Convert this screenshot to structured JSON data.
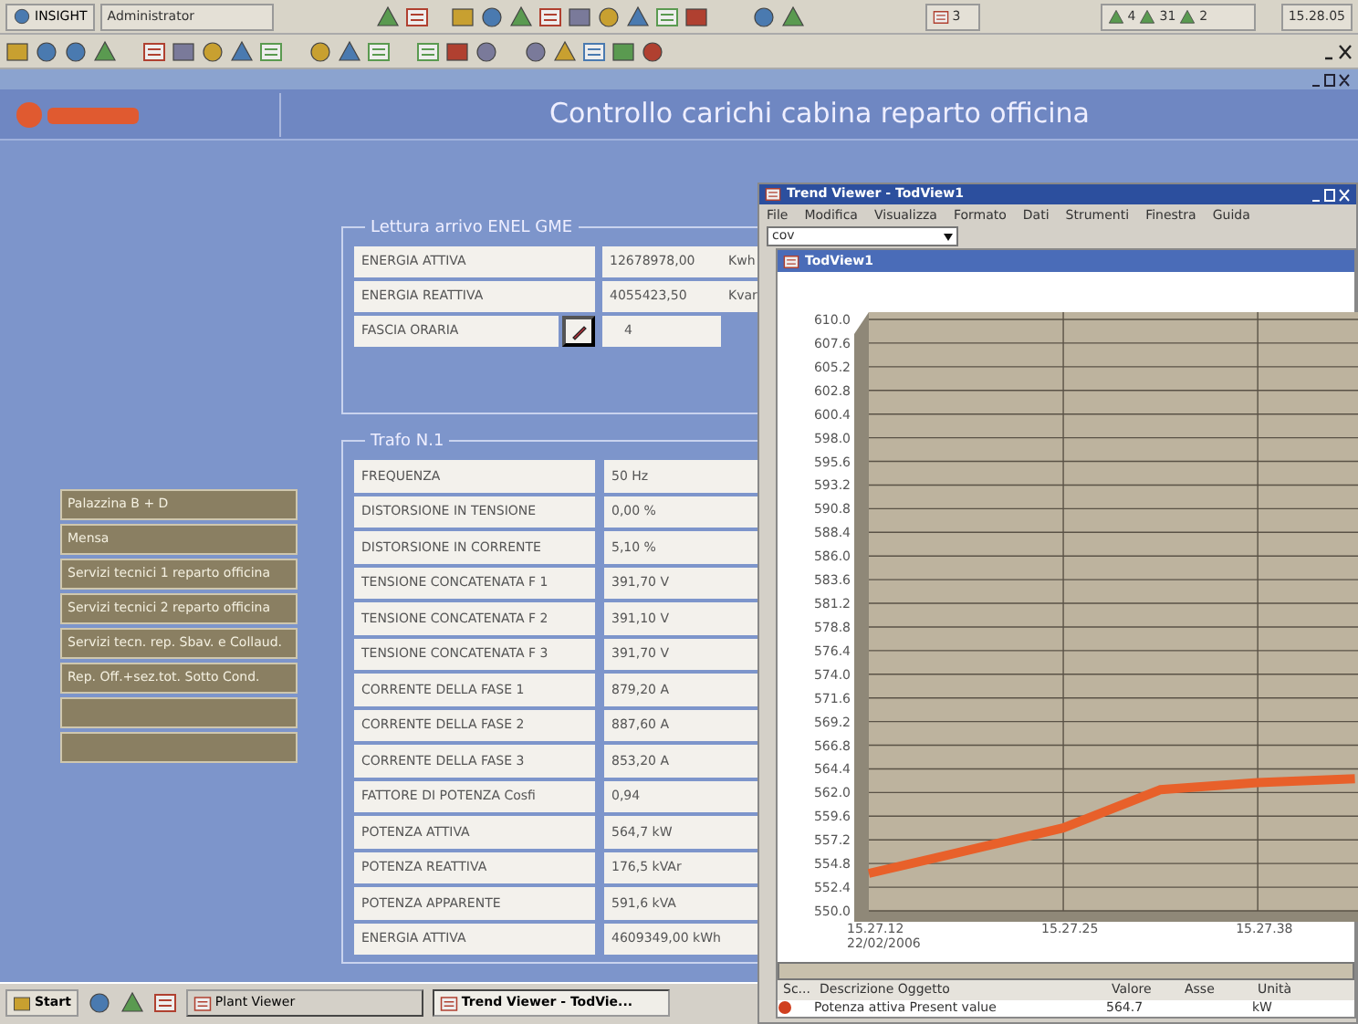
{
  "app_toolbar": {
    "app_button": "INSIGHT",
    "user": "Administrator",
    "counter": "3",
    "alarms": [
      {
        "count": "4"
      },
      {
        "count": "31"
      },
      {
        "count": "2"
      }
    ],
    "time": "15.28.05"
  },
  "header": {
    "title": "Controllo carichi cabina reparto officina"
  },
  "sidebar": {
    "items": [
      {
        "kind": "label",
        "label": "Palazzina B + D"
      },
      {
        "kind": "label",
        "label": "Mensa"
      },
      {
        "kind": "label",
        "label": "Servizi tecnici 1 reparto officina"
      },
      {
        "kind": "label",
        "label": "Servizi tecnici 2 reparto officina"
      },
      {
        "kind": "label",
        "label": "Servizi tecn. rep. Sbav. e Collaud."
      },
      {
        "kind": "label",
        "label": "Rep. Off.+sez.tot. Sotto Cond."
      },
      {
        "kind": "blank"
      },
      {
        "kind": "blank"
      }
    ]
  },
  "enel_reading": {
    "title": "Lettura arrivo ENEL GME",
    "rows": [
      {
        "kind": "plain",
        "label": "ENERGIA ATTIVA",
        "value": "12678978,00",
        "unit": "Kwh"
      },
      {
        "kind": "plain",
        "label": "ENERGIA REATTIVA",
        "value": "4055423,50",
        "unit": "Kvar"
      },
      {
        "kind": "button",
        "label": "FASCIA ORARIA",
        "value": "4"
      }
    ]
  },
  "transformer": {
    "title": "Trafo N.1",
    "rows": [
      {
        "label": "FREQUENZA",
        "value": "50 Hz"
      },
      {
        "label": "DISTORSIONE IN TENSIONE",
        "value": "0,00 %"
      },
      {
        "label": "DISTORSIONE IN CORRENTE",
        "value": "5,10 %"
      },
      {
        "label": "TENSIONE CONCATENATA F 1",
        "value": "391,70 V"
      },
      {
        "label": "TENSIONE CONCATENATA F 2",
        "value": "391,10 V"
      },
      {
        "label": "TENSIONE CONCATENATA F 3",
        "value": "391,70 V"
      },
      {
        "label": "CORRENTE DELLA FASE 1",
        "value": "879,20 A"
      },
      {
        "label": "CORRENTE DELLA FASE 2",
        "value": "887,60 A"
      },
      {
        "label": "CORRENTE DELLA FASE 3",
        "value": "853,20 A"
      },
      {
        "label": "FATTORE DI POTENZA Cosfi",
        "value": "0,94"
      },
      {
        "label": "POTENZA ATTIVA",
        "value": "564,7 kW"
      },
      {
        "label": "POTENZA REATTIVA",
        "value": "176,5 kVAr"
      },
      {
        "label": "POTENZA APPARENTE",
        "value": "591,6 kVA"
      },
      {
        "label": "ENERGIA ATTIVA",
        "value": "4609349,00 kWh"
      }
    ]
  },
  "trend_viewer": {
    "title": "Trend Viewer - TodView1",
    "menu": [
      "File",
      "Modifica",
      "Visualizza",
      "Formato",
      "Dati",
      "Strumenti",
      "Finestra",
      "Guida"
    ],
    "combo_value": "cov",
    "subwindow_title": "TodView1",
    "start_date": "22/02/2006",
    "chart_data": {
      "type": "line",
      "categories": [
        "15.27.12",
        null,
        "15.27.25",
        null,
        "15.27.38",
        null
      ],
      "series": [
        {
          "color": "#e8602a",
          "values": [
            553.8,
            556.1,
            558.4,
            562.3,
            563.0,
            563.4
          ]
        }
      ],
      "ylim": [
        550,
        610
      ],
      "grid": true,
      "yticks": [
        {
          "value": 550,
          "label": "550.0"
        },
        {
          "value": 552.4,
          "label": "552.4"
        },
        {
          "value": 554.8,
          "label": "554.8"
        },
        {
          "value": 557.2,
          "label": "557.2"
        },
        {
          "value": 559.6,
          "label": "559.6"
        },
        {
          "value": 562,
          "label": "562.0"
        },
        {
          "value": 564.4,
          "label": "564.4"
        },
        {
          "value": 566.8,
          "label": "566.8"
        },
        {
          "value": 569.2,
          "label": "569.2"
        },
        {
          "value": 571.6,
          "label": "571.6"
        },
        {
          "value": 574,
          "label": "574.0"
        },
        {
          "value": 576.4,
          "label": "576.4"
        },
        {
          "value": 578.8,
          "label": "578.8"
        },
        {
          "value": 581.2,
          "label": "581.2"
        },
        {
          "value": 583.6,
          "label": "583.6"
        },
        {
          "value": 586,
          "label": "586.0"
        },
        {
          "value": 588.4,
          "label": "588.4"
        },
        {
          "value": 590.8,
          "label": "590.8"
        },
        {
          "value": 593.2,
          "label": "593.2"
        },
        {
          "value": 595.6,
          "label": "595.6"
        },
        {
          "value": 598,
          "label": "598.0"
        },
        {
          "value": 600.4,
          "label": "600.4"
        },
        {
          "value": 602.8,
          "label": "602.8"
        },
        {
          "value": 605.2,
          "label": "605.2"
        },
        {
          "value": 607.6,
          "label": "607.6"
        },
        {
          "value": 610,
          "label": "610.0"
        }
      ]
    },
    "table": {
      "columns": [
        "Sc...",
        "Descrizione Oggetto",
        "Valore",
        "Asse",
        "Unità"
      ],
      "rows": [
        {
          "description": "Potenza attiva Present value",
          "value": "564.7",
          "unit": "kW"
        }
      ]
    }
  },
  "taskbar": {
    "start": "Start",
    "tasks": [
      {
        "label": "Plant Viewer",
        "selected": false
      },
      {
        "label": "Trend Viewer - TodVie...",
        "selected": true
      }
    ]
  }
}
